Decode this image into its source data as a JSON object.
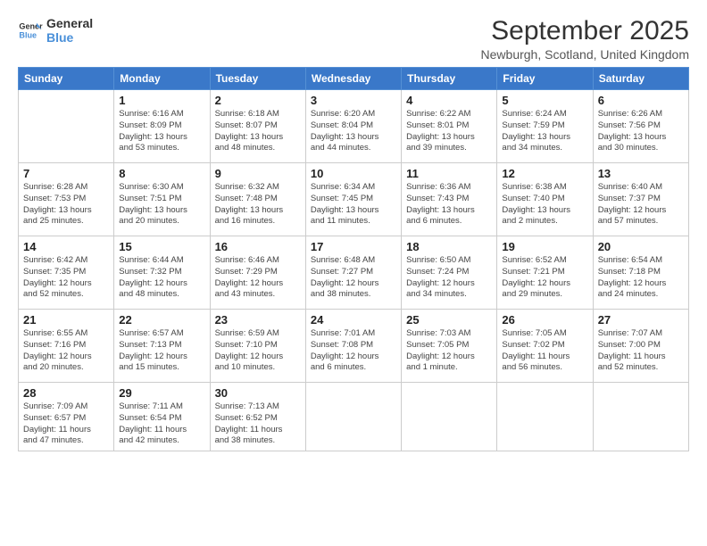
{
  "logo": {
    "line1": "General",
    "line2": "Blue"
  },
  "title": "September 2025",
  "location": "Newburgh, Scotland, United Kingdom",
  "days_of_week": [
    "Sunday",
    "Monday",
    "Tuesday",
    "Wednesday",
    "Thursday",
    "Friday",
    "Saturday"
  ],
  "weeks": [
    [
      {
        "day": "",
        "info": ""
      },
      {
        "day": "1",
        "info": "Sunrise: 6:16 AM\nSunset: 8:09 PM\nDaylight: 13 hours\nand 53 minutes."
      },
      {
        "day": "2",
        "info": "Sunrise: 6:18 AM\nSunset: 8:07 PM\nDaylight: 13 hours\nand 48 minutes."
      },
      {
        "day": "3",
        "info": "Sunrise: 6:20 AM\nSunset: 8:04 PM\nDaylight: 13 hours\nand 44 minutes."
      },
      {
        "day": "4",
        "info": "Sunrise: 6:22 AM\nSunset: 8:01 PM\nDaylight: 13 hours\nand 39 minutes."
      },
      {
        "day": "5",
        "info": "Sunrise: 6:24 AM\nSunset: 7:59 PM\nDaylight: 13 hours\nand 34 minutes."
      },
      {
        "day": "6",
        "info": "Sunrise: 6:26 AM\nSunset: 7:56 PM\nDaylight: 13 hours\nand 30 minutes."
      }
    ],
    [
      {
        "day": "7",
        "info": "Sunrise: 6:28 AM\nSunset: 7:53 PM\nDaylight: 13 hours\nand 25 minutes."
      },
      {
        "day": "8",
        "info": "Sunrise: 6:30 AM\nSunset: 7:51 PM\nDaylight: 13 hours\nand 20 minutes."
      },
      {
        "day": "9",
        "info": "Sunrise: 6:32 AM\nSunset: 7:48 PM\nDaylight: 13 hours\nand 16 minutes."
      },
      {
        "day": "10",
        "info": "Sunrise: 6:34 AM\nSunset: 7:45 PM\nDaylight: 13 hours\nand 11 minutes."
      },
      {
        "day": "11",
        "info": "Sunrise: 6:36 AM\nSunset: 7:43 PM\nDaylight: 13 hours\nand 6 minutes."
      },
      {
        "day": "12",
        "info": "Sunrise: 6:38 AM\nSunset: 7:40 PM\nDaylight: 13 hours\nand 2 minutes."
      },
      {
        "day": "13",
        "info": "Sunrise: 6:40 AM\nSunset: 7:37 PM\nDaylight: 12 hours\nand 57 minutes."
      }
    ],
    [
      {
        "day": "14",
        "info": "Sunrise: 6:42 AM\nSunset: 7:35 PM\nDaylight: 12 hours\nand 52 minutes."
      },
      {
        "day": "15",
        "info": "Sunrise: 6:44 AM\nSunset: 7:32 PM\nDaylight: 12 hours\nand 48 minutes."
      },
      {
        "day": "16",
        "info": "Sunrise: 6:46 AM\nSunset: 7:29 PM\nDaylight: 12 hours\nand 43 minutes."
      },
      {
        "day": "17",
        "info": "Sunrise: 6:48 AM\nSunset: 7:27 PM\nDaylight: 12 hours\nand 38 minutes."
      },
      {
        "day": "18",
        "info": "Sunrise: 6:50 AM\nSunset: 7:24 PM\nDaylight: 12 hours\nand 34 minutes."
      },
      {
        "day": "19",
        "info": "Sunrise: 6:52 AM\nSunset: 7:21 PM\nDaylight: 12 hours\nand 29 minutes."
      },
      {
        "day": "20",
        "info": "Sunrise: 6:54 AM\nSunset: 7:18 PM\nDaylight: 12 hours\nand 24 minutes."
      }
    ],
    [
      {
        "day": "21",
        "info": "Sunrise: 6:55 AM\nSunset: 7:16 PM\nDaylight: 12 hours\nand 20 minutes."
      },
      {
        "day": "22",
        "info": "Sunrise: 6:57 AM\nSunset: 7:13 PM\nDaylight: 12 hours\nand 15 minutes."
      },
      {
        "day": "23",
        "info": "Sunrise: 6:59 AM\nSunset: 7:10 PM\nDaylight: 12 hours\nand 10 minutes."
      },
      {
        "day": "24",
        "info": "Sunrise: 7:01 AM\nSunset: 7:08 PM\nDaylight: 12 hours\nand 6 minutes."
      },
      {
        "day": "25",
        "info": "Sunrise: 7:03 AM\nSunset: 7:05 PM\nDaylight: 12 hours\nand 1 minute."
      },
      {
        "day": "26",
        "info": "Sunrise: 7:05 AM\nSunset: 7:02 PM\nDaylight: 11 hours\nand 56 minutes."
      },
      {
        "day": "27",
        "info": "Sunrise: 7:07 AM\nSunset: 7:00 PM\nDaylight: 11 hours\nand 52 minutes."
      }
    ],
    [
      {
        "day": "28",
        "info": "Sunrise: 7:09 AM\nSunset: 6:57 PM\nDaylight: 11 hours\nand 47 minutes."
      },
      {
        "day": "29",
        "info": "Sunrise: 7:11 AM\nSunset: 6:54 PM\nDaylight: 11 hours\nand 42 minutes."
      },
      {
        "day": "30",
        "info": "Sunrise: 7:13 AM\nSunset: 6:52 PM\nDaylight: 11 hours\nand 38 minutes."
      },
      {
        "day": "",
        "info": ""
      },
      {
        "day": "",
        "info": ""
      },
      {
        "day": "",
        "info": ""
      },
      {
        "day": "",
        "info": ""
      }
    ]
  ]
}
